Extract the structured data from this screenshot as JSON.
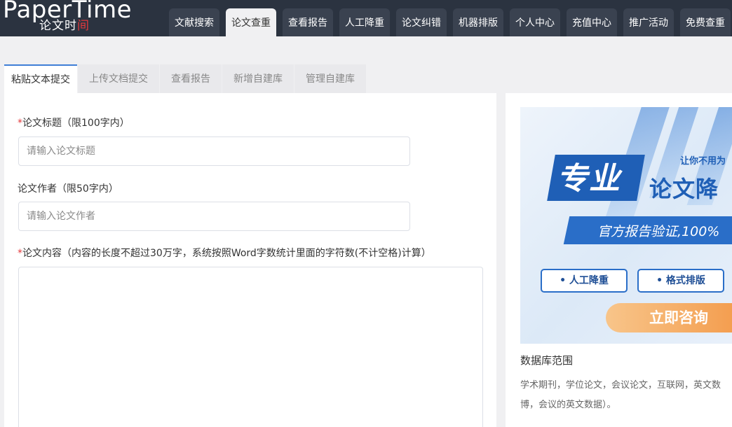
{
  "logo": {
    "main": "PaperTime",
    "sub_a": "论文时",
    "sub_b": "间"
  },
  "nav": {
    "tabs": [
      {
        "label": "文献搜索"
      },
      {
        "label": "论文查重"
      },
      {
        "label": "查看报告"
      },
      {
        "label": "人工降重"
      },
      {
        "label": "论文纠错"
      },
      {
        "label": "机器排版"
      },
      {
        "label": "个人中心"
      },
      {
        "label": "充值中心"
      },
      {
        "label": "推广活动"
      },
      {
        "label": "免费查重"
      }
    ]
  },
  "subtabs": [
    {
      "label": "粘贴文本提交"
    },
    {
      "label": "上传文档提交"
    },
    {
      "label": "查看报告"
    },
    {
      "label": "新增自建库"
    },
    {
      "label": "管理自建库"
    }
  ],
  "form": {
    "required_mark": "*",
    "title_label": "论文标题（限100字内）",
    "title_placeholder": "请输入论文标题",
    "author_label": "论文作者（限50字内）",
    "author_placeholder": "请输入论文作者",
    "content_label": "论文内容（内容的长度不超过30万字，系统按照Word字数统计里面的字符数(不计空格)计算）"
  },
  "banner": {
    "hint": "让你不用为",
    "big": "专业",
    "big2": "论文降",
    "band": "官方报告验证,100%",
    "pill_1": "• 人工降重",
    "pill_2": "• 格式排版",
    "cta": "立即咨询"
  },
  "sidebar": {
    "db_title": "数据库范围",
    "db_text": "学术期刊，学位论文，会议论文，互联网，英文数博，会议的英文数据）。"
  },
  "colors": {
    "topbar": "#2b3340",
    "accent": "#3f7ed6",
    "required": "#e4393c",
    "banner_blue": "#1f5fb6",
    "cta_orange": "#f39a4a"
  }
}
